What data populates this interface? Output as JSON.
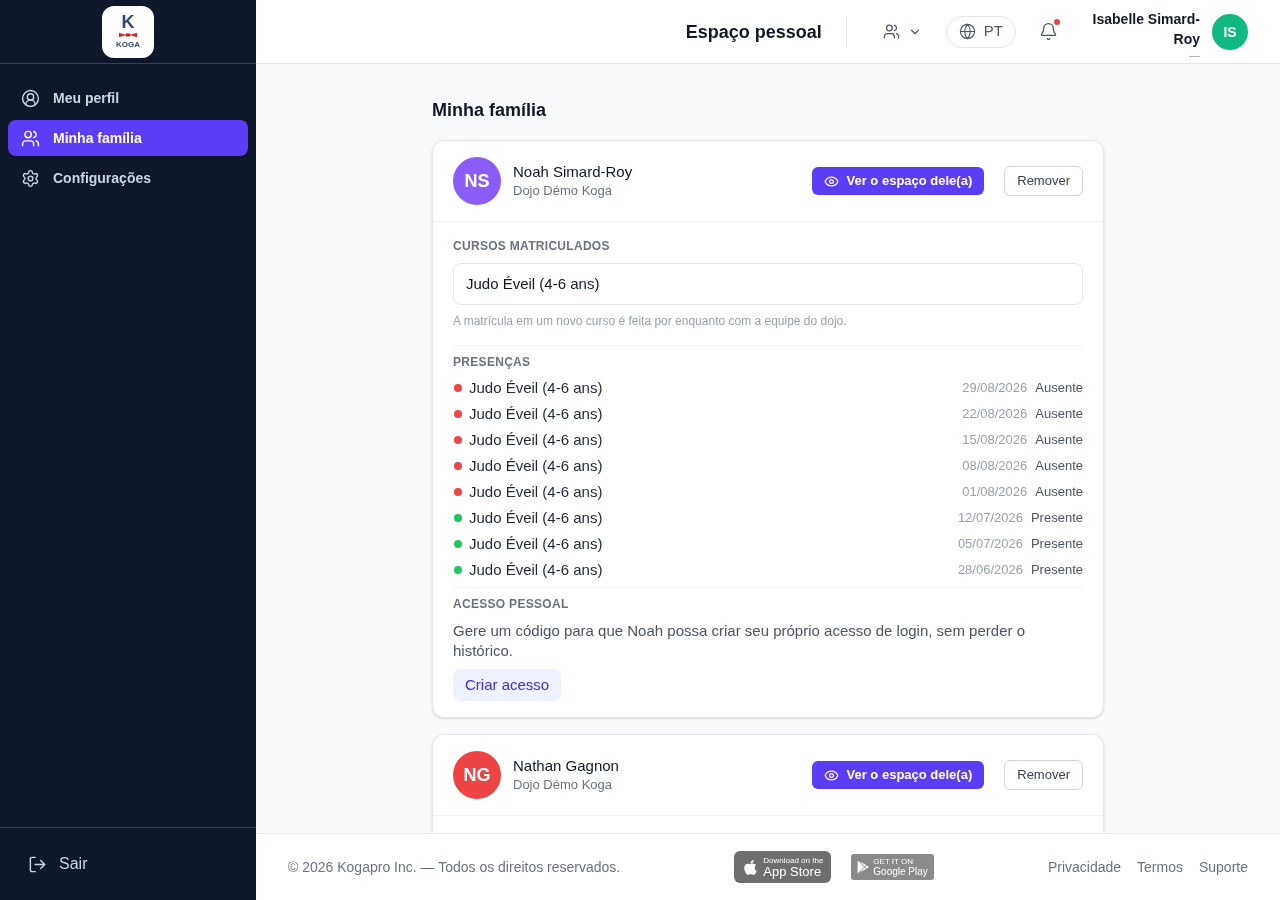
{
  "sidebar": {
    "logo": {
      "letter": "K",
      "wordmark": "KOGA"
    },
    "items": [
      {
        "label": "Meu perfil",
        "selected": false
      },
      {
        "label": "Minha família",
        "selected": true
      },
      {
        "label": "Configurações",
        "selected": false
      }
    ],
    "logout": "Sair"
  },
  "header": {
    "title": "Espaço pessoal",
    "language": "PT",
    "notifications": {
      "unread": true
    },
    "user": {
      "name": "Isabelle Simard-Roy",
      "subtitle": "—",
      "initials": "IS"
    }
  },
  "page": {
    "title": "Minha família"
  },
  "members": [
    {
      "initials": "NS",
      "color": "#8b5cf6",
      "name": "Noah Simard-Roy",
      "dojo": "Dojo Démo Koga",
      "view_button": "Ver o espaço dele(a)",
      "remove_button": "Remover",
      "courses": {
        "label": "CURSOS MATRICULADOS",
        "items": [
          "Judo Éveil (4-6 ans)"
        ],
        "note": "A matrícula em um novo curso é feita por enquanto com a equipe do dojo."
      },
      "attendance": {
        "label": "PRESENÇAS",
        "rows": [
          {
            "course": "Judo Éveil (4-6 ans)",
            "date": "29/08/2026",
            "status": "Ausente",
            "color": "#ef4444"
          },
          {
            "course": "Judo Éveil (4-6 ans)",
            "date": "22/08/2026",
            "status": "Ausente",
            "color": "#ef4444"
          },
          {
            "course": "Judo Éveil (4-6 ans)",
            "date": "15/08/2026",
            "status": "Ausente",
            "color": "#ef4444"
          },
          {
            "course": "Judo Éveil (4-6 ans)",
            "date": "08/08/2026",
            "status": "Ausente",
            "color": "#ef4444"
          },
          {
            "course": "Judo Éveil (4-6 ans)",
            "date": "01/08/2026",
            "status": "Ausente",
            "color": "#ef4444"
          },
          {
            "course": "Judo Éveil (4-6 ans)",
            "date": "12/07/2026",
            "status": "Presente",
            "color": "#22c55e"
          },
          {
            "course": "Judo Éveil (4-6 ans)",
            "date": "05/07/2026",
            "status": "Presente",
            "color": "#22c55e"
          },
          {
            "course": "Judo Éveil (4-6 ans)",
            "date": "28/06/2026",
            "status": "Presente",
            "color": "#22c55e"
          }
        ]
      },
      "access": {
        "label": "ACESSO PESSOAL",
        "text": "Gere um código para que Noah possa criar seu próprio acesso de login, sem perder o histórico.",
        "button": "Criar acesso"
      }
    },
    {
      "initials": "NG",
      "color": "#ef4444",
      "name": "Nathan Gagnon",
      "dojo": "Dojo Démo Koga",
      "view_button": "Ver o espaço dele(a)",
      "remove_button": "Remover"
    }
  ],
  "footer": {
    "copyright": "© 2026 Kogapro Inc. — Todos os direitos reservados.",
    "badges": [
      {
        "kind": "app-store",
        "caption": "Download on the",
        "store": "App Store"
      },
      {
        "kind": "google-play",
        "caption": "GET IT ON",
        "store": "Google Play"
      }
    ],
    "links": [
      "Privacidade",
      "Termos",
      "Suporte"
    ]
  }
}
